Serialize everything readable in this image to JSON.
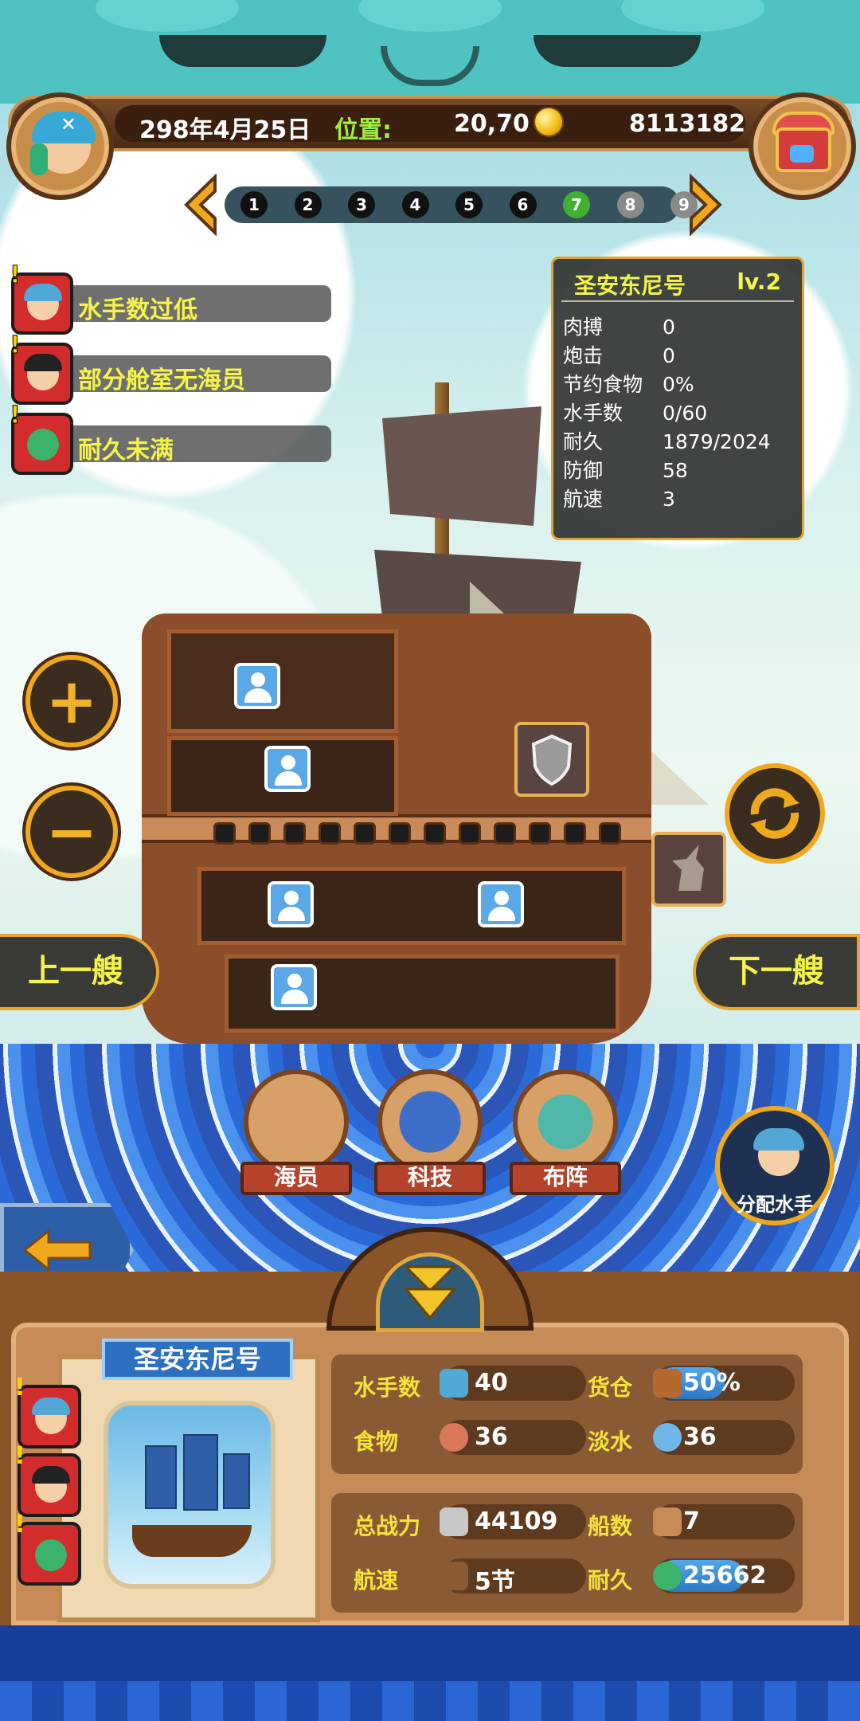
{
  "header": {
    "date": "298年4月25日",
    "location_label": "位置:",
    "location_value": "20,70",
    "gold": "8113182"
  },
  "pager": {
    "pages": [
      "1",
      "2",
      "3",
      "4",
      "5",
      "6",
      "7",
      "8",
      "9"
    ],
    "active_page": "7",
    "unlocked_count": 7
  },
  "alerts": [
    {
      "label": "水手数过低",
      "icon": "sailor-icon"
    },
    {
      "label": "部分舱室无海员",
      "icon": "pirate-captain-icon"
    },
    {
      "label": "耐久未满",
      "icon": "ship-repair-icon"
    }
  ],
  "ship_info": {
    "name": "圣安东尼号",
    "level": "lv.2",
    "stats": [
      {
        "key": "肉搏",
        "value": "0"
      },
      {
        "key": "炮击",
        "value": "0"
      },
      {
        "key": "节约食物",
        "value": "0%"
      },
      {
        "key": "水手数",
        "value": "0/60"
      },
      {
        "key": "耐久",
        "value": "1879/2024"
      },
      {
        "key": "防御",
        "value": "58"
      },
      {
        "key": "航速",
        "value": "3"
      }
    ]
  },
  "side_controls": {
    "zoom_in": "+",
    "zoom_out": "−",
    "prev_ship": "上一艘",
    "next_ship": "下一艘"
  },
  "menu": {
    "crew": "海员",
    "tech": "科技",
    "formation": "布阵",
    "assign_sailors": "分配水手"
  },
  "fleet_panel": {
    "ship_name": "圣安东尼号",
    "sailors_label": "水手数",
    "sailors_value": "40",
    "cargo_label": "货仓",
    "cargo_value": "50%",
    "cargo_fill": 0.5,
    "food_label": "食物",
    "food_value": "36",
    "water_label": "淡水",
    "water_value": "36",
    "power_label": "总战力",
    "power_value": "44109",
    "ships_label": "船数",
    "ships_value": "7",
    "speed_label": "航速",
    "speed_value": "5节",
    "durability_label": "耐久",
    "durability_value": "25662",
    "durability_fill": 0.65
  },
  "colors": {
    "alert_text": "#f4f44a",
    "location_label": "#a2f03d",
    "active_page": "#3fb030",
    "panel_accent": "#e3a232"
  }
}
